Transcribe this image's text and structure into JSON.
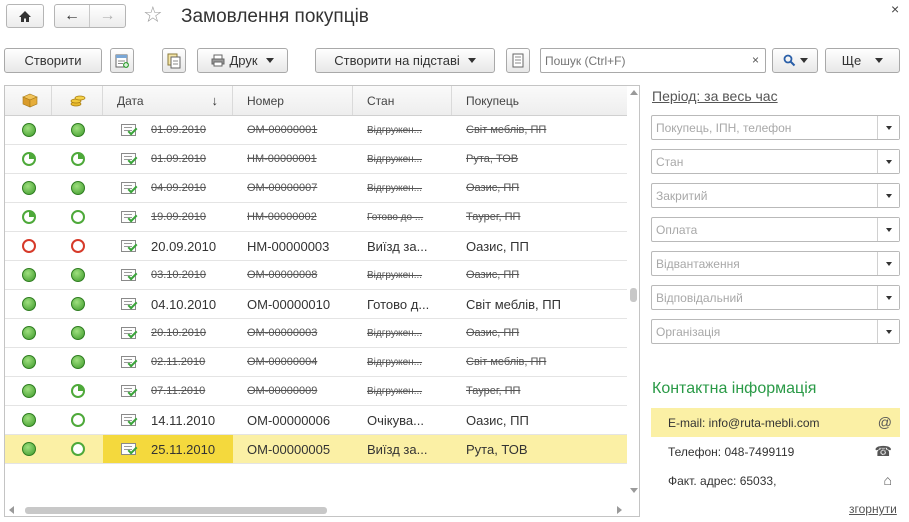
{
  "window": {
    "title": "Замовлення покупців"
  },
  "toolbar": {
    "create_label": "Створити",
    "print_label": "Друк",
    "create_based_label": "Створити на підставі",
    "search_placeholder": "Пошук (Ctrl+F)",
    "search_clear": "×",
    "more_label": "Ще"
  },
  "table": {
    "columns": {
      "date": "Дата",
      "number": "Номер",
      "state": "Стан",
      "customer": "Покупець"
    },
    "sort_arrow": "↓",
    "rows": [
      {
        "status1": "green",
        "status2": "green",
        "date": "01.09.2010",
        "number": "ОМ-00000001",
        "state": "Відгружен...",
        "customer": "Світ меблів, ПП",
        "struck": true,
        "selected": false
      },
      {
        "status1": "clock",
        "status2": "clock",
        "date": "01.09.2010",
        "number": "НМ-00000001",
        "state": "Відгружен...",
        "customer": "Рута, ТОВ",
        "struck": true,
        "selected": false
      },
      {
        "status1": "green",
        "status2": "green",
        "date": "04.09.2010",
        "number": "ОМ-00000007",
        "state": "Відгружен...",
        "customer": "Оазис, ПП",
        "struck": true,
        "selected": false
      },
      {
        "status1": "clock",
        "status2": "ring-green",
        "date": "19.09.2010",
        "number": "НМ-00000002",
        "state": "Готово до ...",
        "customer": "Таурег, ПП",
        "struck": true,
        "selected": false
      },
      {
        "status1": "ring-red",
        "status2": "ring-red",
        "date": "20.09.2010",
        "number": "НМ-00000003",
        "state": "Виїзд за...",
        "customer": "Оазис, ПП",
        "struck": false,
        "selected": false
      },
      {
        "status1": "green",
        "status2": "green",
        "date": "03.10.2010",
        "number": "ОМ-00000008",
        "state": "Відгружен...",
        "customer": "Оазис, ПП",
        "struck": true,
        "selected": false
      },
      {
        "status1": "green",
        "status2": "green",
        "date": "04.10.2010",
        "number": "ОМ-00000010",
        "state": "Готово д...",
        "customer": "Світ меблів, ПП",
        "struck": false,
        "selected": false
      },
      {
        "status1": "green",
        "status2": "green",
        "date": "20.10.2010",
        "number": "ОМ-00000003",
        "state": "Відгружен...",
        "customer": "Оазис, ПП",
        "struck": true,
        "selected": false
      },
      {
        "status1": "green",
        "status2": "green",
        "date": "02.11.2010",
        "number": "ОМ-00000004",
        "state": "Відгружен...",
        "customer": "Світ меблів, ПП",
        "struck": true,
        "selected": false
      },
      {
        "status1": "green",
        "status2": "clock",
        "date": "07.11.2010",
        "number": "ОМ-00000009",
        "state": "Відгружен...",
        "customer": "Таурег, ПП",
        "struck": true,
        "selected": false
      },
      {
        "status1": "green",
        "status2": "ring-green",
        "date": "14.11.2010",
        "number": "ОМ-00000006",
        "state": "Очікува...",
        "customer": "Оазис, ПП",
        "struck": false,
        "selected": false
      },
      {
        "status1": "green",
        "status2": "ring-green",
        "date": "25.11.2010",
        "number": "ОМ-00000005",
        "state": "Виїзд за...",
        "customer": "Рута, ТОВ",
        "struck": false,
        "selected": true
      }
    ]
  },
  "panel": {
    "period_label": "Період: за весь час",
    "filters": [
      "Покупець, ІПН, телефон",
      "Стан",
      "Закритий",
      "Оплата",
      "Відвантаження",
      "Відповідальний",
      "Організація"
    ],
    "contact_header": "Контактна інформація",
    "contacts": [
      {
        "text": "E-mail: info@ruta-mebli.com",
        "icon": "@",
        "icon_name": "email-icon"
      },
      {
        "text": "Телефон: 048-7499119",
        "icon": "☎",
        "icon_name": "phone-icon"
      },
      {
        "text": "Факт. адрес: 65033,",
        "icon": "⌂",
        "icon_name": "home-icon"
      }
    ],
    "collapse_label": "згорнути"
  },
  "colors": {
    "selection": "#fbf0a5",
    "date_highlight": "#f4d93d",
    "contact_header": "#2a9a47"
  }
}
